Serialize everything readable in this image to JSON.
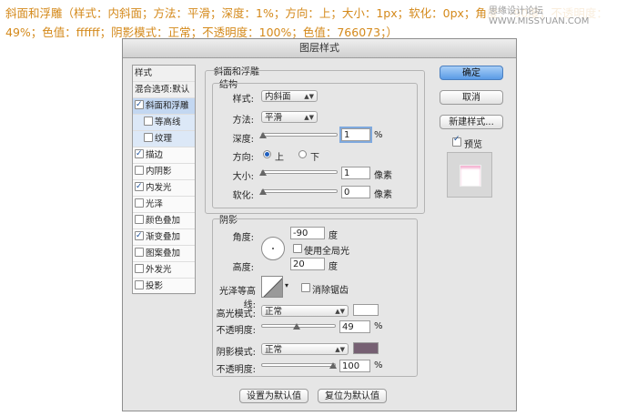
{
  "caption": "斜面和浮雕（样式：内斜面；方法：平滑；深度：1%；方向：上；大小：1px；软化：0px；角度：-90度；不透明度：49%；色值：ffffff；阴影模式：正常；不透明度：100%；色值：766073；）",
  "watermark": "思缘设计论坛 WWW.MISSYUAN.COM",
  "dialog": {
    "title": "图层样式",
    "styles_list": {
      "header": "样式",
      "blend": "混合选项:默认",
      "items": [
        {
          "label": "斜面和浮雕",
          "checked": true,
          "selected": true,
          "sub": false
        },
        {
          "label": "等高线",
          "checked": false,
          "selected": false,
          "sub": true
        },
        {
          "label": "纹理",
          "checked": false,
          "selected": false,
          "sub": true
        },
        {
          "label": "描边",
          "checked": true,
          "selected": false,
          "sub": false
        },
        {
          "label": "内阴影",
          "checked": false,
          "selected": false,
          "sub": false
        },
        {
          "label": "内发光",
          "checked": true,
          "selected": false,
          "sub": false
        },
        {
          "label": "光泽",
          "checked": false,
          "selected": false,
          "sub": false
        },
        {
          "label": "颜色叠加",
          "checked": false,
          "selected": false,
          "sub": false
        },
        {
          "label": "渐变叠加",
          "checked": true,
          "selected": false,
          "sub": false
        },
        {
          "label": "图案叠加",
          "checked": false,
          "selected": false,
          "sub": false
        },
        {
          "label": "外发光",
          "checked": false,
          "selected": false,
          "sub": false
        },
        {
          "label": "投影",
          "checked": false,
          "selected": false,
          "sub": false
        }
      ]
    },
    "bevel": {
      "section_title": "斜面和浮雕",
      "structure_title": "结构",
      "style_label": "样式:",
      "style_value": "内斜面",
      "technique_label": "方法:",
      "technique_value": "平滑",
      "depth_label": "深度:",
      "depth_value": "1",
      "depth_unit": "%",
      "direction_label": "方向:",
      "direction_up": "上",
      "direction_down": "下",
      "size_label": "大小:",
      "size_value": "1",
      "size_unit": "像素",
      "soften_label": "软化:",
      "soften_value": "0",
      "soften_unit": "像素"
    },
    "shading": {
      "section_title": "阴影",
      "angle_label": "角度:",
      "angle_value": "-90",
      "angle_unit": "度",
      "global_light_label": "使用全局光",
      "altitude_label": "高度:",
      "altitude_value": "20",
      "altitude_unit": "度",
      "gloss_contour_label": "光泽等高线:",
      "anti_alias_label": "消除锯齿",
      "highlight_mode_label": "高光模式:",
      "highlight_mode_value": "正常",
      "highlight_opacity_label": "不透明度:",
      "highlight_opacity_value": "49",
      "highlight_color": "#ffffff",
      "shadow_mode_label": "阴影模式:",
      "shadow_mode_value": "正常",
      "shadow_opacity_label": "不透明度:",
      "shadow_opacity_value": "100",
      "shadow_color": "#766073",
      "percent": "%"
    },
    "buttons": {
      "ok": "确定",
      "cancel": "取消",
      "new_style": "新建样式...",
      "preview": "预览",
      "make_default": "设置为默认值",
      "reset_default": "复位为默认值"
    }
  }
}
